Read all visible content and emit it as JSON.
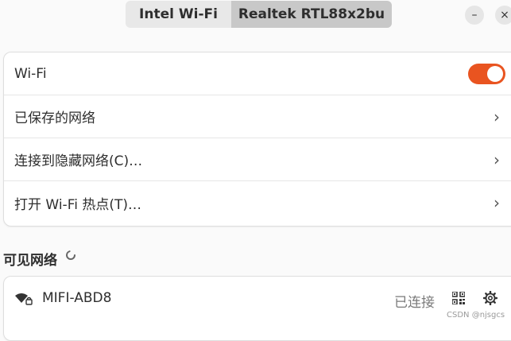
{
  "adapters": {
    "tab1": "Intel Wi-Fi",
    "tab2": "Realtek RTL88x2bu",
    "active": 2
  },
  "window": {
    "minimize_icon": "minimize-icon",
    "close_icon": "close-icon",
    "minimize_glyph": "–",
    "close_glyph": "×"
  },
  "settings": {
    "wifi_label": "Wi-Fi",
    "wifi_enabled": true,
    "saved_networks": "已保存的网络",
    "connect_hidden": "连接到隐藏网络(C)…",
    "hotspot": "打开 Wi-Fi 热点(T)…",
    "chevron": "›"
  },
  "visible_networks": {
    "title": "可见网络",
    "items": [
      {
        "name": "MIFI-ABD8",
        "status": "已连接"
      }
    ]
  },
  "colors": {
    "accent": "#e95420",
    "card": "#ffffff",
    "background": "#fafafa"
  },
  "watermark": "CSDN @njsgcs"
}
